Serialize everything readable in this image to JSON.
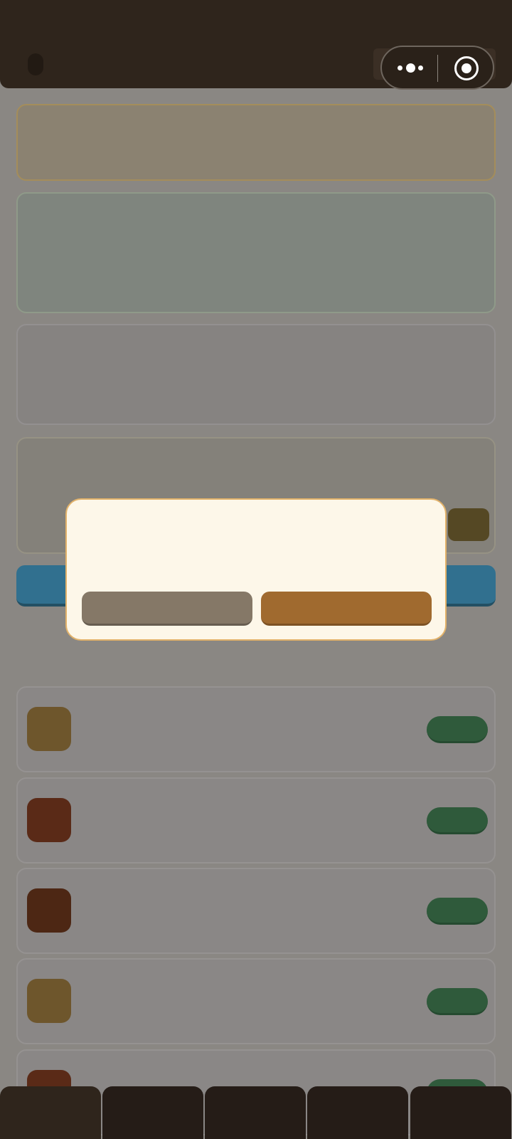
{
  "header": {
    "back_icon": "back-icon",
    "menu_icon": "more-dots-icon",
    "close_icon": "target-close-icon"
  },
  "list": {
    "items": [
      {
        "thumb_color": "#6e562c"
      },
      {
        "thumb_color": "#5a2a17"
      },
      {
        "thumb_color": "#4d2714"
      },
      {
        "thumb_color": "#6e562c"
      },
      {
        "thumb_color": "#5a2a17"
      }
    ]
  },
  "tabs": [
    {
      "active": true
    },
    {
      "active": false
    },
    {
      "active": false
    },
    {
      "active": false
    },
    {
      "active": false
    }
  ],
  "modal": {
    "cancel_color": "#857867",
    "confirm_color": "#a06a2f"
  },
  "colors": {
    "header_bg": "#2f251c",
    "accent_blue": "#31708f",
    "add_button": "#2f5a3b",
    "modal_bg": "#fdf7e9",
    "modal_border": "#e2b26a"
  }
}
